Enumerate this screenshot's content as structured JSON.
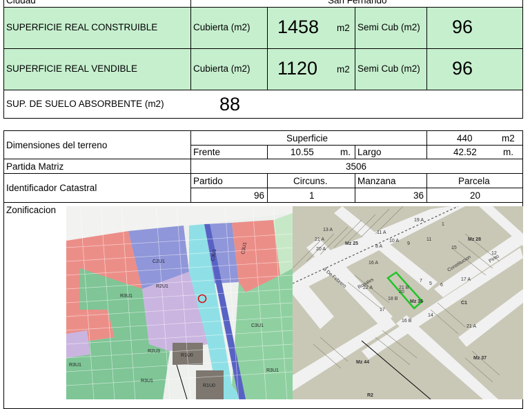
{
  "top": {
    "ciudad_label": "Ciudad",
    "ciudad_value": "San Fernando",
    "rows": [
      {
        "label": "SUPERFICIE REAL CONSTRUIBLE",
        "cubierta_label": "Cubierta (m2)",
        "cubierta_value": "1458",
        "unit": "m2",
        "semi_label": "Semi Cub (m2)",
        "semi_value": "96"
      },
      {
        "label": "SUPERFICIE REAL VENDIBLE",
        "cubierta_label": "Cubierta (m2)",
        "cubierta_value": "1120",
        "unit": "m2",
        "semi_label": "Semi Cub (m2)",
        "semi_value": "96"
      }
    ],
    "absorbente_label": "SUP. DE SUELO ABSORBENTE (m2)",
    "absorbente_value": "88"
  },
  "bottom": {
    "dimensiones_label": "Dimensiones del terreno",
    "superficie_label": "Superficie",
    "superficie_value": "440",
    "superficie_unit": "m2",
    "frente_label": "Frente",
    "frente_value": "10.55",
    "frente_unit": "m.",
    "largo_label": "Largo",
    "largo_value": "42.52",
    "largo_unit": "m.",
    "partida_label": "Partida Matriz",
    "partida_value": "3506",
    "identificador_label": "Identificador Catastral",
    "partido_label": "Partido",
    "partido_value": "96",
    "circuns_label": "Circuns.",
    "circuns_value": "1",
    "manzana_label": "Manzana",
    "manzana_value": "36",
    "parcela_label": "Parcela",
    "parcela_value": "20",
    "zonificacion_label": "Zonificacion"
  },
  "zoning_map": {
    "zones": [
      "C2U1",
      "C3U1",
      "R2U1",
      "R3U1",
      "C3U1",
      "R3U1",
      "R1U0",
      "R1U0",
      "R3U1",
      "R2U3",
      "C3U1",
      "R3U1"
    ]
  },
  "cadastral_map": {
    "blocks": [
      "Mz 25",
      "Mz 28",
      "Mz 36",
      "Mz 44",
      "Mz 37"
    ],
    "streets": [
      "3 De Febrero",
      "Rosales",
      "Constitucion",
      "Pinto",
      "R2"
    ],
    "parcel_labels": [
      "20",
      "21 B",
      "18 B",
      "16 B",
      "10 A",
      "19 A",
      "8 A",
      "11 A",
      "13 A",
      "20 A",
      "21 A",
      "22 A",
      "17 A",
      "C1",
      "7",
      "5",
      "6",
      "14",
      "17",
      "21 A",
      "1",
      "11",
      "15",
      "12",
      "9",
      "16 A"
    ],
    "colors": {
      "street": "#f1f1f1",
      "block": "#c9c7b6",
      "highlight": "#22c42a"
    }
  }
}
